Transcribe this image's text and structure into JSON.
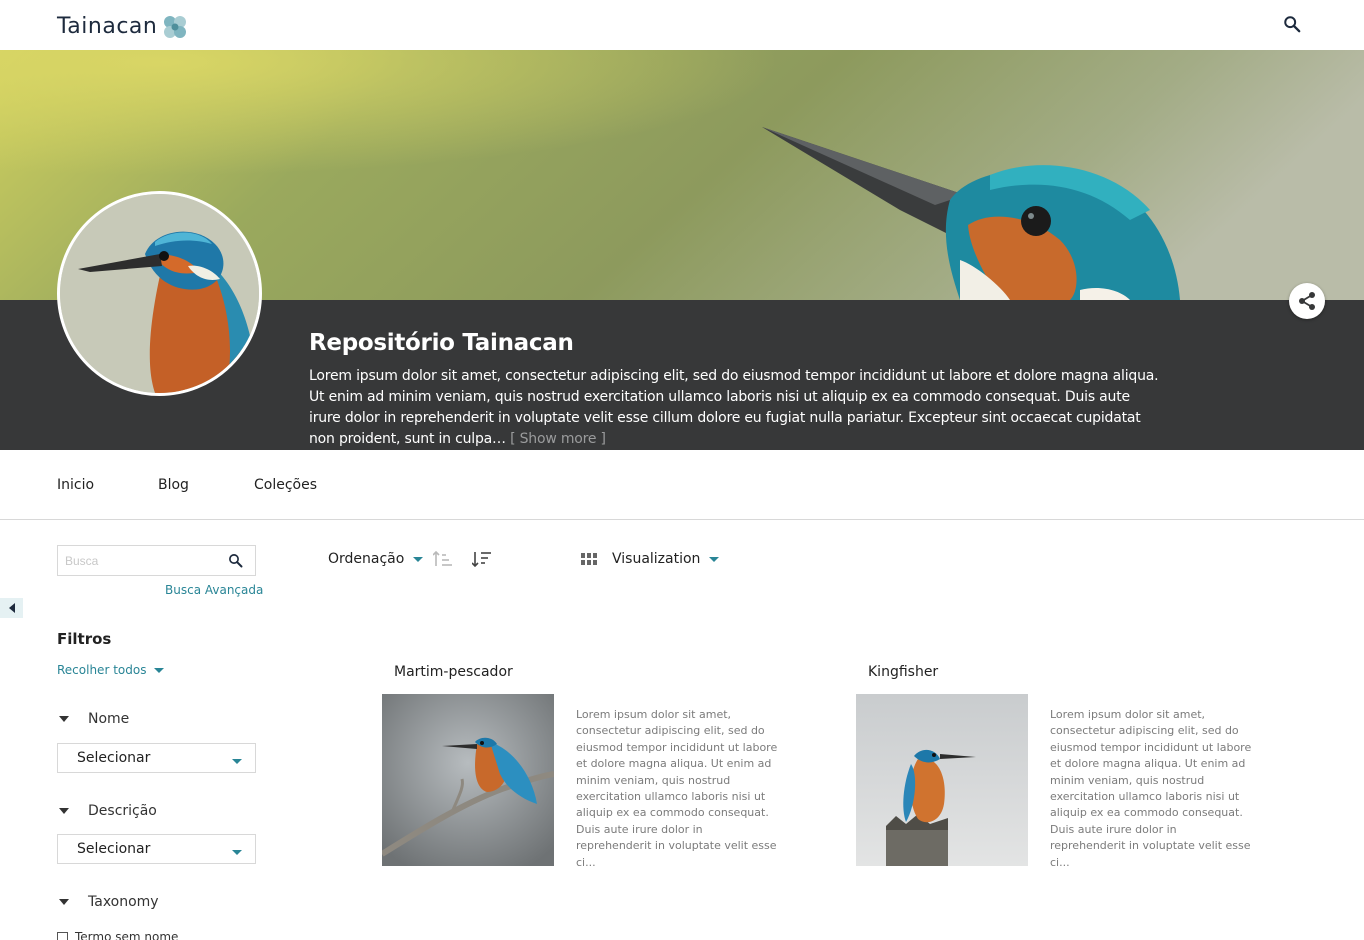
{
  "header": {
    "logo_text": "Tainacan",
    "search_icon": "search-icon"
  },
  "repository": {
    "title": "Repositório Tainacan",
    "description": "Lorem ipsum dolor sit amet, consectetur adipiscing elit, sed do eiusmod tempor incididunt ut labore et dolore magna aliqua. Ut enim ad minim veniam, quis nostrud exercitation ullamco laboris nisi ut aliquip ex ea commodo consequat. Duis aute irure dolor in reprehenderit in voluptate velit esse cillum dolore eu fugiat nulla pariatur. Excepteur sint occaecat cupidatat non proident, sunt in culpa…",
    "show_more": "[ Show more ]",
    "share_icon": "share-icon"
  },
  "nav": {
    "items": [
      "Inicio",
      "Blog",
      "Coleções"
    ]
  },
  "sidebar": {
    "search_placeholder": "Busca",
    "advanced_search": "Busca Avançada",
    "filters_title": "Filtros",
    "collapse_all": "Recolher todos",
    "filters": [
      {
        "label": "Nome",
        "select": "Selecionar"
      },
      {
        "label": "Descrição",
        "select": "Selecionar"
      },
      {
        "label": "Taxonomy",
        "checkbox": "Termo sem nome"
      }
    ]
  },
  "toolbar": {
    "sort_label": "Ordenação",
    "view_label": "Visualization",
    "view_icon": "grid-icon"
  },
  "items": [
    {
      "title": "Martim-pescador",
      "description": "Lorem ipsum dolor sit amet, consectetur adipiscing elit, sed do eiusmod tempor incididunt ut labore et dolore magna aliqua. Ut enim ad minim veniam, quis nostrud exercitation ullamco laboris nisi ut aliquip ex ea commodo consequat. Duis aute irure dolor in reprehenderit in voluptate velit esse ci..."
    },
    {
      "title": "Kingfisher",
      "description": "Lorem ipsum dolor sit amet, consectetur adipiscing elit, sed do eiusmod tempor incididunt ut labore et dolore magna aliqua. Ut enim ad minim veniam, quis nostrud exercitation ullamco laboris nisi ut aliquip ex ea commodo consequat. Duis aute irure dolor in reprehenderit in voluptate velit esse ci..."
    }
  ],
  "colors": {
    "accent": "#298596",
    "dark_band": "#373839",
    "logo": "#1d2a3d"
  }
}
